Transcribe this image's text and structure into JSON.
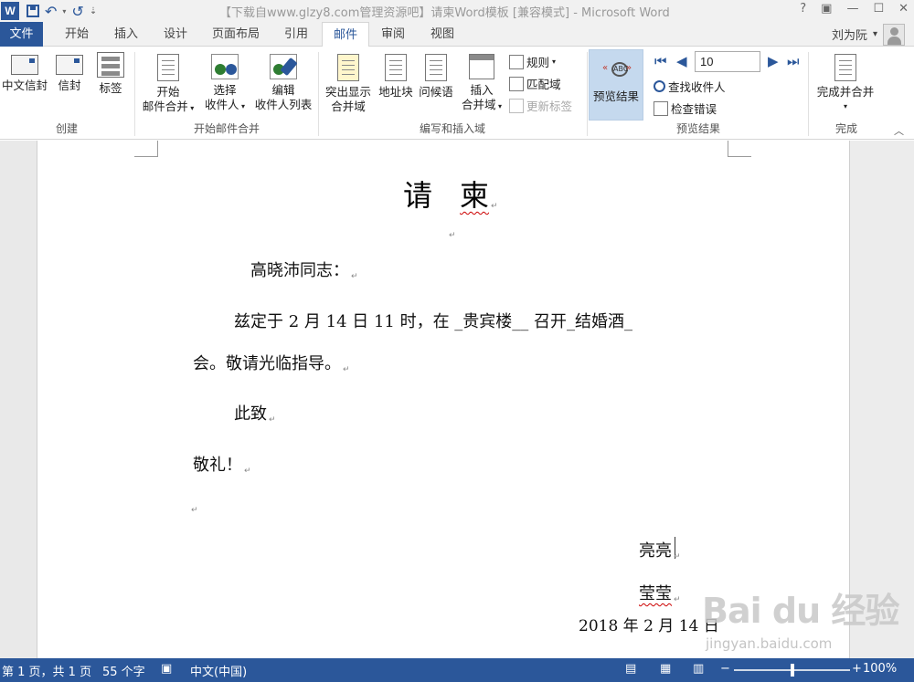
{
  "app": {
    "title": "【下载自www.glzy8.com管理资源吧】请柬Word模板 [兼容模式] - Microsoft Word",
    "word_icon": "W",
    "qat": {
      "save_icon": "save-icon",
      "undo_glyph": "↶",
      "redo_glyph": "↺",
      "customize_glyph": "⇣"
    },
    "window_controls": {
      "help": "?",
      "restore": "▣",
      "minimize": "—",
      "maximize": "☐",
      "close": "✕"
    }
  },
  "tabs": [
    "文件",
    "开始",
    "插入",
    "设计",
    "页面布局",
    "引用",
    "邮件",
    "审阅",
    "视图"
  ],
  "active_tab": "邮件",
  "user": {
    "name": "刘为阮",
    "dropdown": "▾"
  },
  "ribbon": {
    "create": {
      "label": "创建",
      "chinese_envelope": "中文信封",
      "envelopes": "信封",
      "labels": "标签"
    },
    "start_merge": {
      "label": "开始邮件合并",
      "start_line1": "开始",
      "start_line2": "邮件合并",
      "select_line1": "选择",
      "select_line2": "收件人",
      "edit_line1": "编辑",
      "edit_line2": "收件人列表"
    },
    "write_insert": {
      "label": "编写和插入域",
      "highlight_line1": "突出显示",
      "highlight_line2": "合并域",
      "address_block": "地址块",
      "greeting": "问候语",
      "insert_line1": "插入",
      "insert_line2": "合并域",
      "rules": "规则",
      "match_fields": "匹配域",
      "update_labels": "更新标签"
    },
    "preview": {
      "label": "预览结果",
      "preview_results": "预览结果",
      "abc_text": "ABC",
      "record_number": "10",
      "find_recipient": "查找收件人",
      "check_errors": "检查错误"
    },
    "finish": {
      "label": "完成",
      "finish_merge": "完成并合并"
    }
  },
  "document": {
    "title_char1": "请",
    "title_char2": "柬",
    "salutation": "高晓沛同志：",
    "body_line1": "兹定于 2 月 14 日 11 时，在 _贵宾楼__ 召开_结婚酒_",
    "body_line2": "会。敬请光临指导。",
    "closing1": "此致",
    "closing2": "敬礼！",
    "sign1": "亮亮",
    "sign2": "莹莹",
    "date": "2018 年 2 月 14 日",
    "para_mark": "↵"
  },
  "status": {
    "page": "第 1 页，共 1 页",
    "words": "55 个字",
    "language": "中文(中国)",
    "zoom": "100%",
    "zoom_minus": "−",
    "zoom_plus": "+",
    "zoom_level": 0.5
  },
  "watermark": {
    "logo": "Bai du 经验",
    "url": "jingyan.baidu.com"
  }
}
